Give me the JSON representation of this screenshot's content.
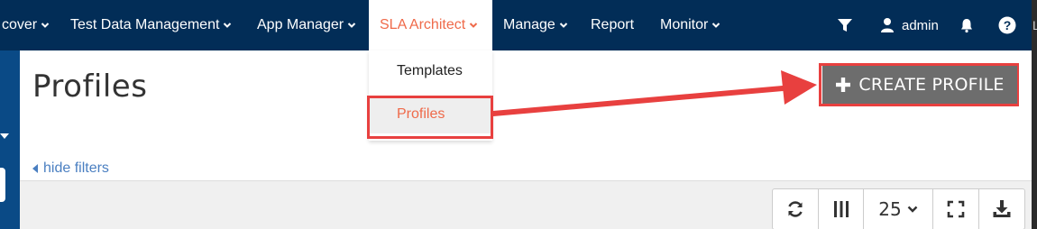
{
  "nav": {
    "items": [
      {
        "label": "cover",
        "has_dropdown": true
      },
      {
        "label": "Test Data Management",
        "has_dropdown": true
      },
      {
        "label": "App Manager",
        "has_dropdown": true
      },
      {
        "label": "SLA Architect",
        "has_dropdown": true,
        "active": true
      },
      {
        "label": "Manage",
        "has_dropdown": true
      },
      {
        "label": "Report",
        "has_dropdown": false
      },
      {
        "label": "Monitor",
        "has_dropdown": true
      }
    ],
    "user": "admin",
    "icons": {
      "filter": "filter-icon",
      "user": "user-icon",
      "bell": "bell-icon",
      "help": "help-icon"
    }
  },
  "dropdown": {
    "items": [
      {
        "label": "Templates"
      },
      {
        "label": "Profiles",
        "selected": true
      }
    ]
  },
  "page": {
    "title": "Profiles",
    "hide_filters": "hide filters",
    "create_button": "CREATE PROFILE"
  },
  "toolbar": {
    "page_size": "25",
    "icons": [
      "refresh-icon",
      "columns-icon",
      "page-size-select",
      "fullscreen-icon",
      "download-icon"
    ]
  },
  "edge_char": "L",
  "colors": {
    "navbar": "#022d57",
    "accent": "#ef6a4a",
    "highlight": "#e8403f",
    "button": "#6d6d6d",
    "link": "#4a7fc1"
  }
}
